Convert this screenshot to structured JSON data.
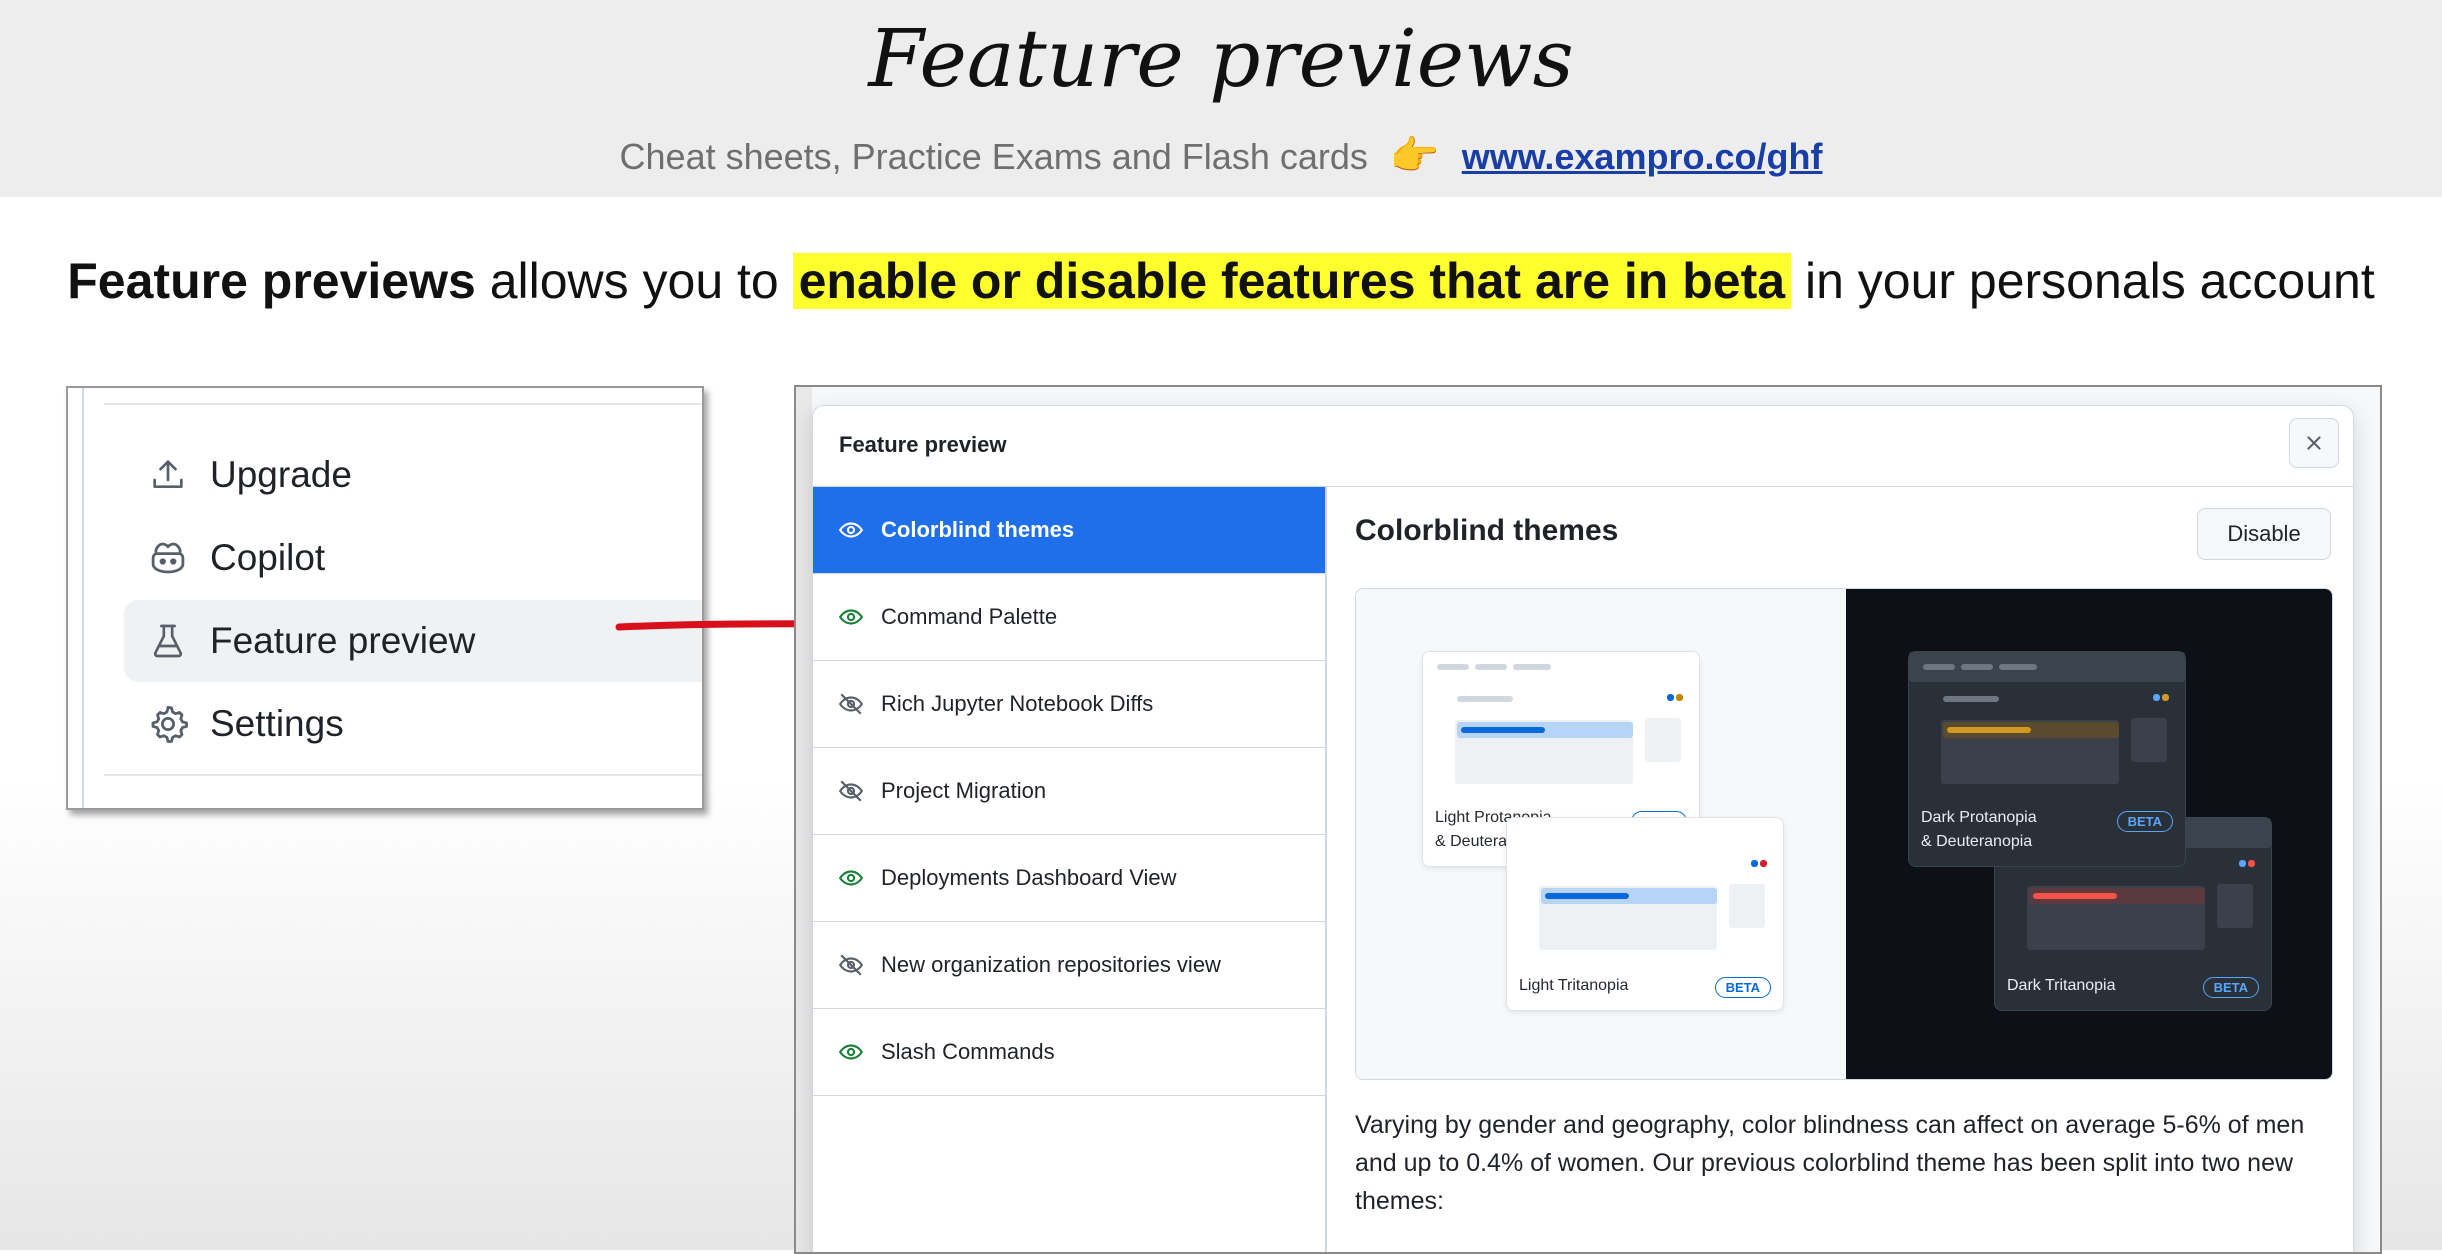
{
  "slide": {
    "title": "Feature previews",
    "subtitle_text": "Cheat sheets, Practice Exams and Flash cards",
    "subtitle_emoji": "👉",
    "subtitle_link": "www.exampro.co/ghf",
    "intro_bold": "Feature previews",
    "intro_mid": " allows you to ",
    "intro_highlight": "enable or disable features that are in beta",
    "intro_end": " in your personals account"
  },
  "menu": {
    "items": [
      {
        "label": "Upgrade",
        "icon": "upload-icon"
      },
      {
        "label": "Copilot",
        "icon": "copilot-icon"
      },
      {
        "label": "Feature preview",
        "icon": "beaker-icon",
        "active": true
      },
      {
        "label": "Settings",
        "icon": "gear-icon"
      }
    ]
  },
  "arrow_color": "#d8101c",
  "modal": {
    "title": "Feature preview",
    "features": [
      {
        "label": "Colorblind themes",
        "enabled": true,
        "selected": true
      },
      {
        "label": "Command Palette",
        "enabled": true
      },
      {
        "label": "Rich Jupyter Notebook Diffs",
        "enabled": false
      },
      {
        "label": "Project Migration",
        "enabled": false
      },
      {
        "label": "Deployments Dashboard View",
        "enabled": true
      },
      {
        "label": "New organization repositories view",
        "enabled": false
      },
      {
        "label": "Slash Commands",
        "enabled": true
      }
    ],
    "detail": {
      "title": "Colorblind themes",
      "button": "Disable",
      "themes": [
        {
          "line1": "Light Protanopia",
          "line2": "& Deuteranopia",
          "beta": "BETA"
        },
        {
          "line1": "Light Tritanopia",
          "beta": "BETA"
        },
        {
          "line1": "Dark Protanopia",
          "line2": "& Deuteranopia",
          "beta": "BETA"
        },
        {
          "line1": "Dark Tritanopia",
          "beta": "BETA"
        }
      ],
      "description": "Varying by gender and geography, color blindness can affect on average 5-6% of men and up to 0.4% of women. Our previous colorblind theme has been split into two new themes:"
    }
  },
  "colors": {
    "selected": "#1f6feb",
    "highlight": "#ffff2e",
    "link": "#1a3ea8"
  }
}
